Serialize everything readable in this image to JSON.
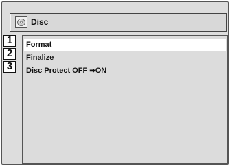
{
  "window": {
    "title": "Disc",
    "icon": "disc-icon"
  },
  "menu": {
    "items": [
      {
        "label": "Format",
        "selected": true
      },
      {
        "label": "Finalize",
        "selected": false
      },
      {
        "label_prefix": "Disc Protect OFF",
        "arrow": "➡",
        "label_suffix": "ON",
        "selected": false
      }
    ]
  },
  "annotations": {
    "steps": [
      "1",
      "2",
      "3"
    ]
  }
}
